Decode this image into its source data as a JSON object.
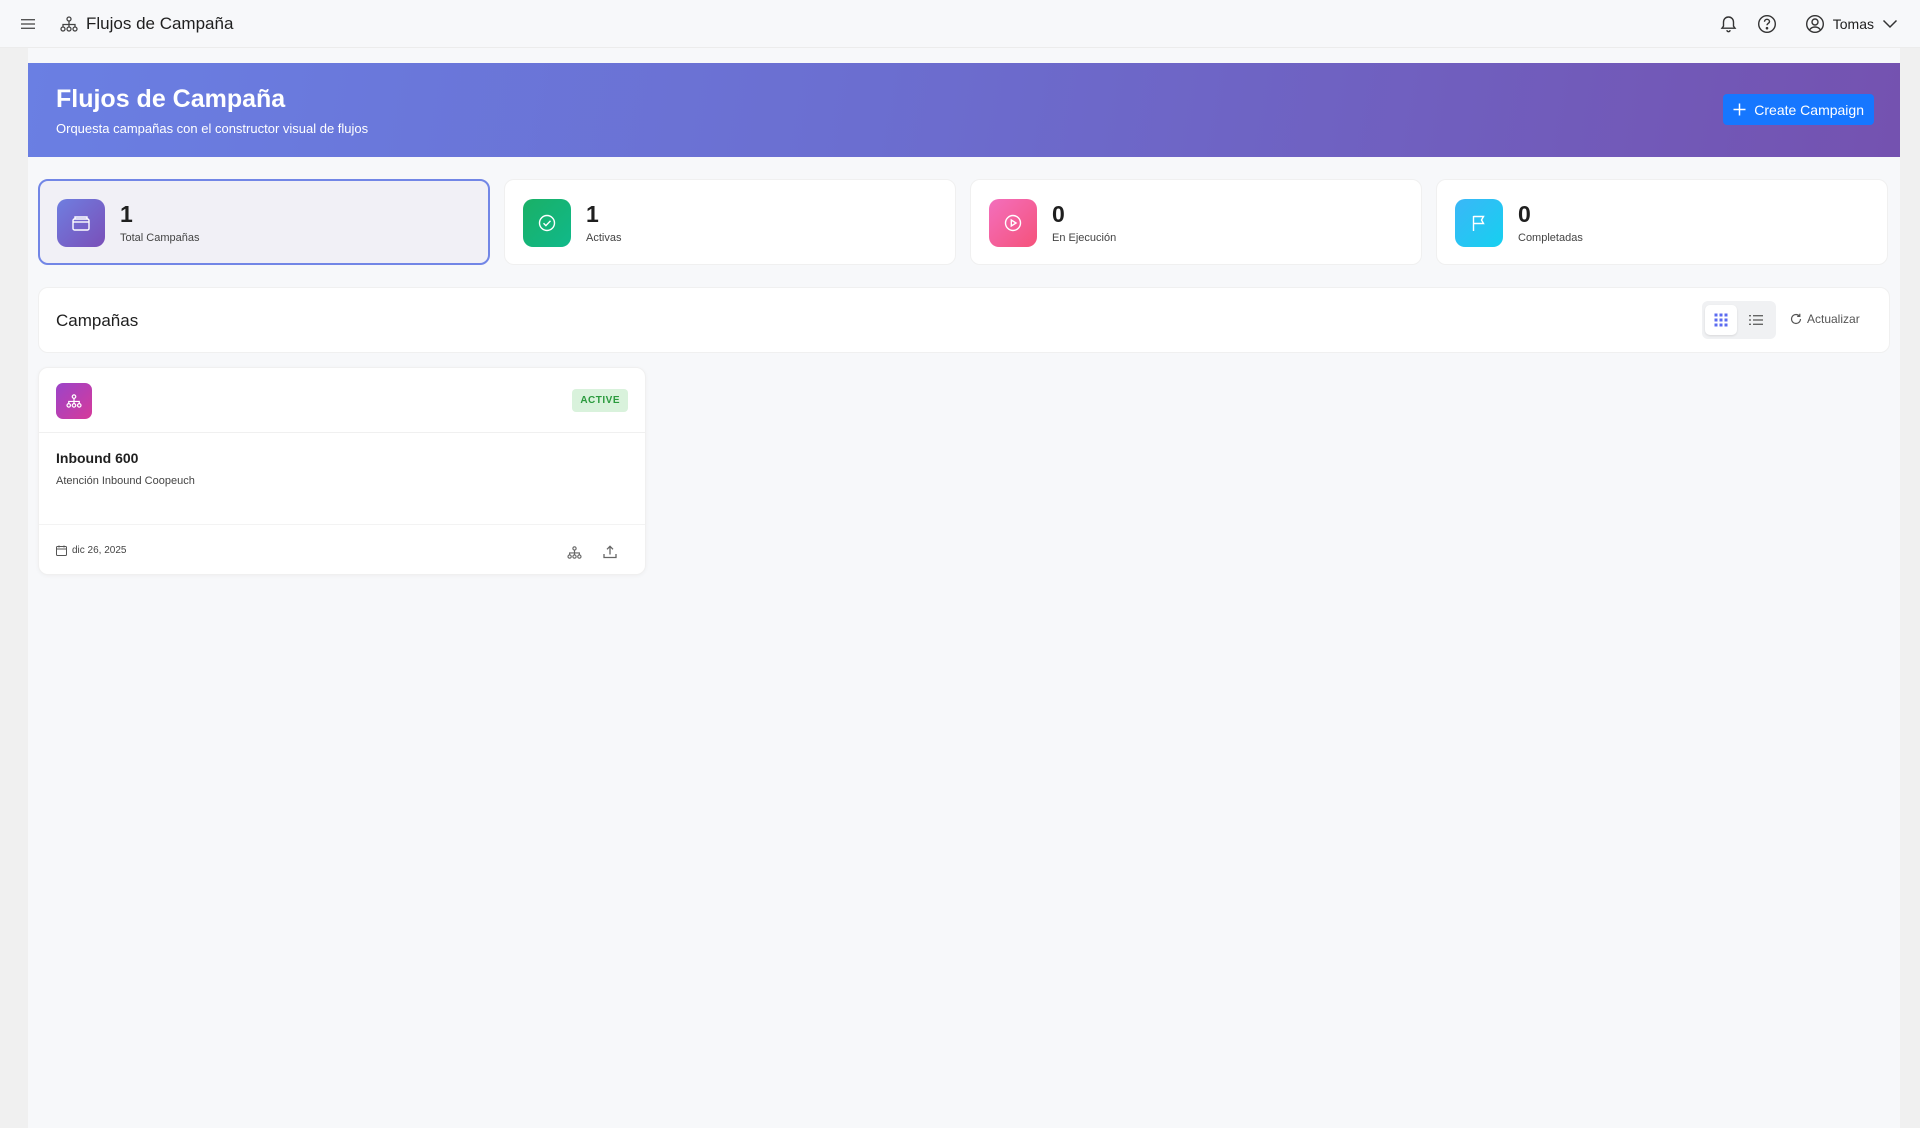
{
  "topbar": {
    "app_title": "Flujos de Campaña",
    "user_name": "Tomas",
    "icons": [
      "menu-icon",
      "sitemap-icon",
      "bell-icon",
      "help-icon",
      "user-circle-icon",
      "chevron-down-icon"
    ]
  },
  "hero": {
    "title": "Flujos de Campaña",
    "subtitle": "Orquesta campañas con el constructor visual de flujos",
    "create_button": "Create Campaign",
    "gradient": [
      "#6a7fe3",
      "#7452b0"
    ]
  },
  "stats": [
    {
      "value": "1",
      "label": "Total Campañas",
      "icon": "folder-icon",
      "colors": [
        "#6f7ee0",
        "#7a4fb8"
      ],
      "selected": true
    },
    {
      "value": "1",
      "label": "Activas",
      "icon": "check-circle-icon",
      "colors": [
        "#1ab066",
        "#10b98a"
      ],
      "selected": false
    },
    {
      "value": "0",
      "label": "En Ejecución",
      "icon": "play-circle-icon",
      "colors": [
        "#f36fbd",
        "#f5527a"
      ],
      "selected": false
    },
    {
      "value": "0",
      "label": "Completadas",
      "icon": "flag-icon",
      "colors": [
        "#3ab7f7",
        "#16d0f0"
      ],
      "selected": false
    }
  ],
  "campaigns_panel": {
    "title": "Campañas",
    "refresh_label": "Actualizar",
    "view_mode": "grid"
  },
  "campaigns": [
    {
      "name": "Inbound 600",
      "description": "Atención Inbound Coopeuch",
      "status": "ACTIVE",
      "date": "dic 26, 2025",
      "icon": "sitemap-icon"
    }
  ],
  "colors": {
    "primary": "#1677ff",
    "active_badge_bg": "#d9f2dc",
    "active_badge_text": "#2a9a3d"
  }
}
